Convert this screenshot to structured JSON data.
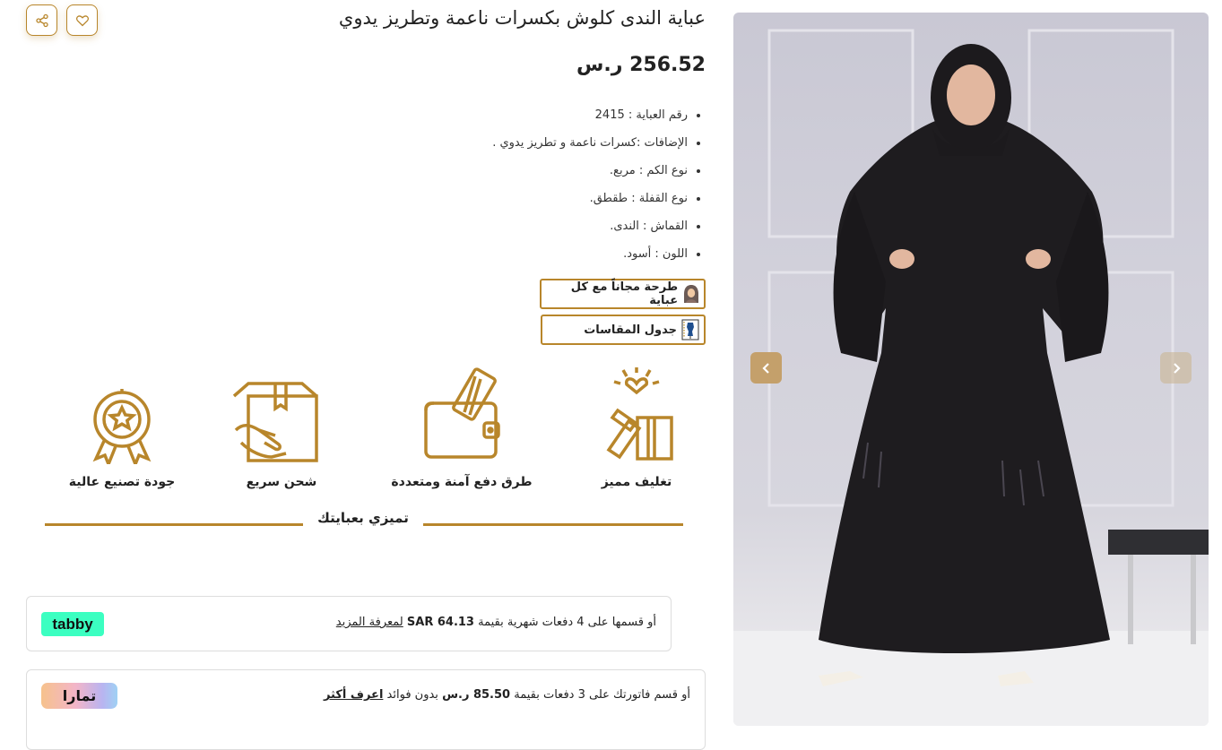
{
  "actions": {
    "share_icon": "share-icon",
    "favorite_icon": "heart-icon"
  },
  "product": {
    "title": "عباية الندى كلوش بكسرات ناعمة وتطريز يدوي",
    "price": "256.52 ر.س",
    "specs": [
      "رقم العباية : 2415",
      "الإضافات :كسرات ناعمة و تطريز يدوي .",
      "نوع الكم : مربع.",
      "نوع القفلة : طقطق.",
      "القماش : الندى.",
      "اللون : أسود."
    ]
  },
  "chips": {
    "tarha": "طرحة مجاناً مع كل عباية",
    "sizes": "جدول المقاسات"
  },
  "features": {
    "wrap": "تغليف مميز",
    "payment": "طرق دفع آمنة ومتعددة",
    "shipping": "شحن سريع",
    "quality": "جودة تصنيع عالية"
  },
  "section_title": "تميزي بعبايتك",
  "tabby": {
    "text_before": "أو قسمها على 4 دفعات شهرية بقيمة",
    "amount": "SAR 64.13",
    "link": "لمعرفة المزيد",
    "logo": "tabby"
  },
  "tamara": {
    "text_before": "أو قسم فاتورتك على 3 دفعات بقيمة",
    "amount": "85.50 ر.س",
    "text_after": "بدون فوائد",
    "link": "اعرف أكثر",
    "logo": "تمارا"
  },
  "colors": {
    "accent": "#b8862b",
    "tabby_green": "#3bffc1",
    "arrow": "#c4a06b"
  }
}
